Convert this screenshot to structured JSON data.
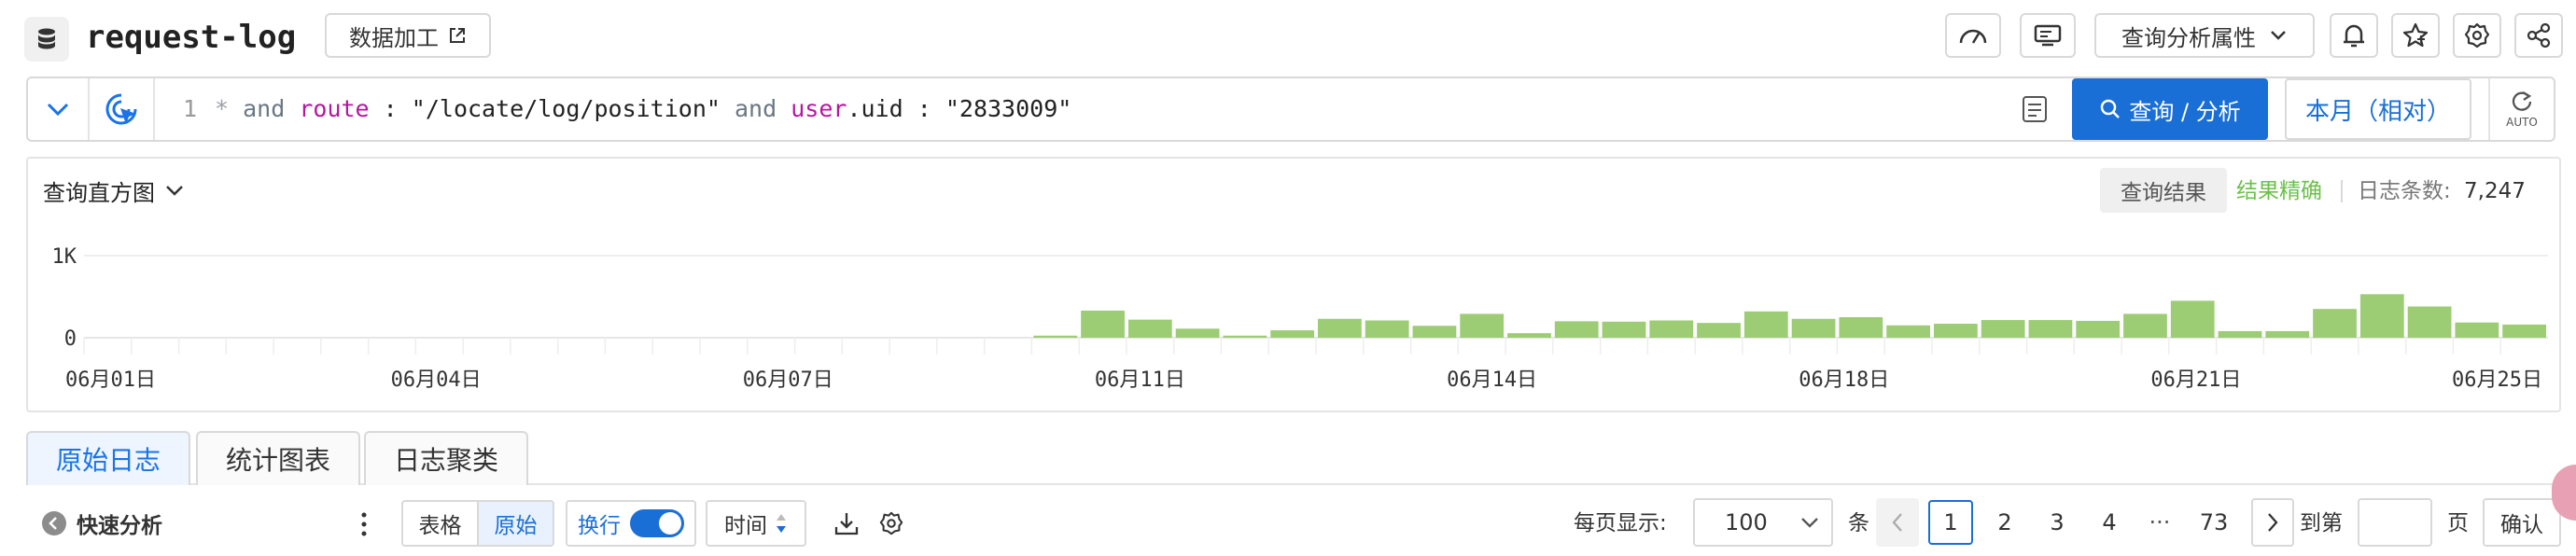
{
  "header": {
    "logstore_name": "request-log",
    "data_process_label": "数据加工",
    "query_analysis_props_label": "查询分析属性"
  },
  "search": {
    "line_number": "1",
    "query_tokens": [
      {
        "text": "*",
        "kind": "op"
      },
      {
        "text": "and",
        "kind": "kw"
      },
      {
        "text": "route",
        "kind": "field"
      },
      {
        "text": ":",
        "kind": "plain"
      },
      {
        "text": "\"/locate/log/position\"",
        "kind": "plain"
      },
      {
        "text": "and",
        "kind": "kw"
      },
      {
        "text": "user",
        "kind": "field"
      },
      {
        "text": ".uid",
        "kind": "plain"
      },
      {
        "text": ":",
        "kind": "plain"
      },
      {
        "text": "\"2833009\"",
        "kind": "plain"
      }
    ],
    "query_button_label": "查询 / 分析",
    "time_range_label": "本月（相对）",
    "auto_label": "AUTO"
  },
  "histogram": {
    "title": "查询直方图",
    "result_tab_label": "查询结果",
    "accuracy_label": "结果精确",
    "log_count_label": "日志条数:",
    "log_count_value": "7,247"
  },
  "chart_data": {
    "type": "bar",
    "yticks": [
      "1K",
      "0"
    ],
    "ylim": [
      0,
      1000
    ],
    "xticks": [
      "06月01日",
      "06月04日",
      "06月07日",
      "06月11日",
      "06月14日",
      "06月18日",
      "06月21日",
      "06月25日"
    ],
    "bar_color": "#9ccc73",
    "values": [
      0,
      0,
      0,
      0,
      0,
      0,
      0,
      0,
      0,
      0,
      0,
      0,
      0,
      0,
      0,
      0,
      0,
      0,
      0,
      0,
      25,
      330,
      220,
      110,
      25,
      90,
      230,
      210,
      145,
      290,
      55,
      200,
      195,
      210,
      180,
      320,
      230,
      250,
      150,
      170,
      215,
      215,
      205,
      290,
      450,
      80,
      80,
      350,
      530,
      380,
      185,
      160
    ]
  },
  "tabs": [
    "原始日志",
    "统计图表",
    "日志聚类"
  ],
  "toolbar": {
    "quick_analysis_label": "快速分析",
    "view_table_label": "表格",
    "view_raw_label": "原始",
    "wrap_label": "换行",
    "time_sort_label": "时间"
  },
  "pagination": {
    "per_page_label": "每页显示:",
    "per_page_value": "100",
    "unit_label": "条",
    "pages": [
      "1",
      "2",
      "3",
      "4"
    ],
    "ellipsis": "···",
    "last_page": "73",
    "goto_label": "到第",
    "page_suffix_label": "页",
    "confirm_label": "确认"
  }
}
